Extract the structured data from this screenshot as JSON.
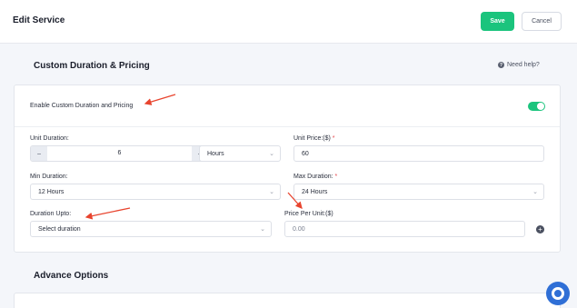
{
  "header": {
    "title": "Edit Service",
    "save_label": "Save",
    "cancel_label": "Cancel"
  },
  "custom_section": {
    "title": "Custom Duration & Pricing",
    "help_label": "Need help?",
    "toggle_label": "Enable Custom Duration and Pricing",
    "toggle_on": true
  },
  "fields": {
    "unit_duration": {
      "label": "Unit Duration:",
      "value": "6",
      "minus": "−",
      "plus": "+",
      "unit": "Hours"
    },
    "unit_price": {
      "label": "Unit Price:($)",
      "required": "*",
      "value": "60"
    },
    "min_duration": {
      "label": "Min Duration:",
      "value": "12 Hours"
    },
    "max_duration": {
      "label": "Max Duration:",
      "required": "*",
      "value": "24 Hours"
    },
    "duration_upto": {
      "label": "Duration Upto:",
      "value": "Select duration"
    },
    "price_per_unit": {
      "label": "Price Per Unit:($)",
      "value": "0.00"
    }
  },
  "advance_section": {
    "title": "Advance Options"
  },
  "colors": {
    "accent": "#1bc47d",
    "annotation": "#e8442e",
    "support": "#2f6fd6"
  }
}
